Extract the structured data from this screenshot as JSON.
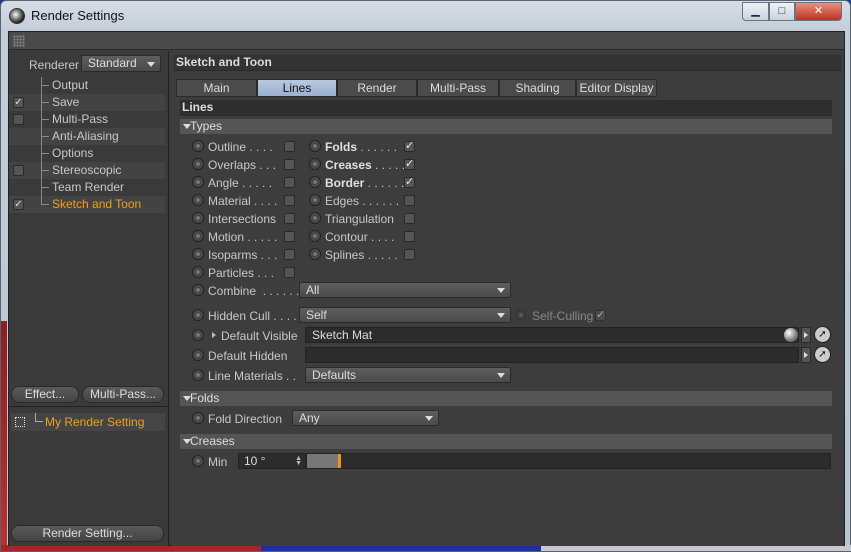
{
  "window": {
    "title": "Render Settings",
    "minimize": "▁",
    "maximize": "□",
    "close": "✕"
  },
  "left": {
    "renderer_label": "Renderer",
    "renderer_value": "Standard",
    "tree": [
      {
        "label": "Output",
        "check": null
      },
      {
        "label": "Save",
        "check": "✓"
      },
      {
        "label": "Multi-Pass",
        "check": ""
      },
      {
        "label": "Anti-Aliasing",
        "check": null
      },
      {
        "label": "Options",
        "check": null
      },
      {
        "label": "Stereoscopic",
        "check": ""
      },
      {
        "label": "Team Render",
        "check": null
      },
      {
        "label": "Sketch and Toon",
        "check": "✓",
        "selected": true
      }
    ],
    "effect_button": "Effect...",
    "multipass_button": "Multi-Pass...",
    "render_setting_name": "My Render Setting",
    "render_setting_button": "Render Setting..."
  },
  "right": {
    "object_title": "Sketch and Toon",
    "tabs": [
      "Main",
      "Lines",
      "Render",
      "Multi-Pass",
      "Shading",
      "Editor Display"
    ],
    "active_tab": "Lines",
    "section": "Lines",
    "groups": {
      "types": "Types",
      "folds": "Folds",
      "creases": "Creases"
    },
    "types_left": [
      {
        "label": "Outline . . . .",
        "checked": ""
      },
      {
        "label": "Overlaps . . .",
        "checked": ""
      },
      {
        "label": "Angle . . . . .",
        "checked": ""
      },
      {
        "label": "Material . . . .",
        "checked": ""
      },
      {
        "label": "Intersections",
        "checked": ""
      },
      {
        "label": "Motion . . . . .",
        "checked": ""
      },
      {
        "label": "Isoparms . . .",
        "checked": ""
      },
      {
        "label": "Particles . . .",
        "checked": ""
      }
    ],
    "types_right": [
      {
        "label": "Folds",
        "dots": " . . . . . .",
        "checked": "✓",
        "bold": true
      },
      {
        "label": "Creases",
        "dots": " . . . . .",
        "checked": "✓",
        "bold": true
      },
      {
        "label": "Border",
        "dots": " . . . . . .",
        "checked": "✓",
        "bold": true
      },
      {
        "label": "Edges",
        "dots": " . . . . . .",
        "checked": "",
        "bold": false
      },
      {
        "label": "Triangulation",
        "dots": "",
        "checked": "",
        "bold": false
      },
      {
        "label": "Contour",
        "dots": " . . . .",
        "checked": "",
        "bold": false
      },
      {
        "label": "Splines",
        "dots": " . . . . .",
        "checked": "",
        "bold": false
      }
    ],
    "combine_label": "Combine  . . . . . . .",
    "combine_value": "All",
    "hidden_cull_label": "Hidden Cull . . . .",
    "hidden_cull_value": "Self",
    "self_culling_label": "Self-Culling",
    "self_culling_check": "✓",
    "default_visible_label": "Default Visible",
    "default_visible_value": "Sketch Mat",
    "default_hidden_label": "Default Hidden",
    "default_hidden_value": "",
    "line_materials_label": "Line Materials . .",
    "line_materials_value": "Defaults",
    "fold_direction_label": "Fold Direction",
    "fold_direction_value": "Any",
    "min_label": "Min",
    "min_value": "10 °",
    "min_slider_fraction": 0.06
  }
}
